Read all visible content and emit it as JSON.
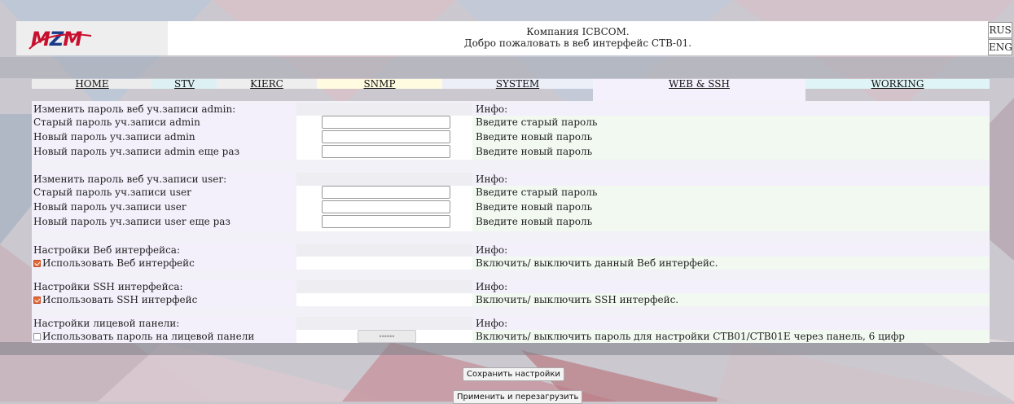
{
  "header": {
    "logo": {
      "m1": "M",
      "z": "Z",
      "m2": "M"
    },
    "company": "Компания ICBCOM.",
    "welcome": "Добро пожаловать в веб интерфейс СТВ-01."
  },
  "lang": {
    "rus": "RUS",
    "eng": "ENG"
  },
  "nav": [
    {
      "label": "HOME",
      "color": "#ececec"
    },
    {
      "label": "STV",
      "color": "#ddf1f5"
    },
    {
      "label": "KIERC",
      "color": "#eeeeee"
    },
    {
      "label": "SNMP",
      "color": "#fffbe0"
    },
    {
      "label": "SYSTEM",
      "color": "#eceef8"
    },
    {
      "label": "WEB & SSH",
      "color": "#f4f0fc",
      "active": true
    },
    {
      "label": "WORKING",
      "color": "#dff4f7"
    }
  ],
  "sections": {
    "admin": {
      "heading": "Изменить пароль веб уч.записи admin:",
      "info_heading": "Инфо:",
      "old_label": "Старый пароль уч.записи admin",
      "old_info": "Введите старый пароль",
      "new_label": "Новый пароль уч.записи admin",
      "new_info": "Введите новый пароль",
      "repeat_label": "Новый пароль уч.записи admin еще раз",
      "repeat_info": "Введите новый пароль"
    },
    "user": {
      "heading": "Изменить пароль веб уч.записи user:",
      "info_heading": "Инфо:",
      "old_label": "Старый пароль уч.записи user",
      "old_info": "Введите старый пароль",
      "new_label": "Новый пароль уч.записи user",
      "new_info": "Введите новый пароль",
      "repeat_label": "Новый пароль уч.записи user еще раз",
      "repeat_info": "Введите новый пароль"
    },
    "web": {
      "heading": "Настройки Веб интерфейса:",
      "info_heading": "Инфо:",
      "checkbox_label": "Использовать Веб интерфейс",
      "checked": true,
      "info": "Включить/ выключить данный Веб интерфейс."
    },
    "ssh": {
      "heading": "Настройки SSH интерфейса:",
      "info_heading": "Инфо:",
      "checkbox_label": "Использовать SSH интерфейс",
      "checked": true,
      "info": "Включить/ выключить SSH интерфейс."
    },
    "panel": {
      "heading": "Настройки лицевой панели:",
      "info_heading": "Инфо:",
      "checkbox_label": "Использовать пароль на лицевой панели",
      "checked": false,
      "pin_value": "••••••",
      "info": "Включить/ выключить пароль для настройки СТВ01/СТВ01Е через панель, 6 цифр"
    }
  },
  "buttons": {
    "save": "Сохранить настройки",
    "apply": "Применить и перезагрузить"
  }
}
